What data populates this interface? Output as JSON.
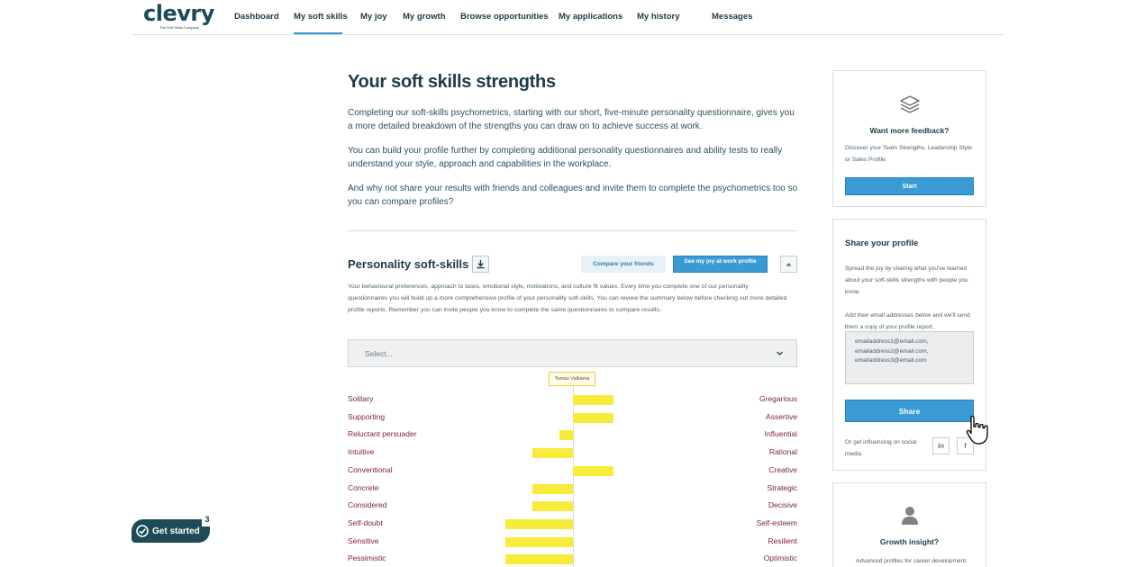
{
  "brand": {
    "name": "clevry",
    "tagline": "The Soft Skills Company"
  },
  "nav": {
    "items": [
      {
        "label": "Dashboard",
        "active": false
      },
      {
        "label": "My soft skills",
        "active": true
      },
      {
        "label": "My joy",
        "active": false
      },
      {
        "label": "My growth",
        "active": false
      },
      {
        "label": "Browse opportunities",
        "active": false
      },
      {
        "label": "My applications",
        "active": false
      },
      {
        "label": "My history",
        "active": false
      },
      {
        "label": "Messages",
        "active": false
      }
    ]
  },
  "main": {
    "title": "Your soft skills strengths",
    "paragraphs": [
      "Completing our soft-skills psychometrics, starting with our short, five-minute personality questionnaire, gives you a more detailed breakdown of the strengths you can draw on to achieve success at work.",
      "You can build your profile further by completing additional personality questionnaires and ability tests to really understand your style, approach and capabilities in the workplace.",
      "And why not share your results with friends and colleagues and invite them to complete the psychometrics too so you can compare profiles?"
    ]
  },
  "personality": {
    "title": "Personality soft-skills",
    "compare_label": "Compare your friends",
    "joy_label": "See my joy at work profile",
    "description": "Your behavioural preferences, approach to tasks, emotional style, motivations, and culture fit values. Every time you complete one of our personality questionnaires you will build up a more comprehensive profile of your personality soft-skills. You can review the summary below before checking out more detailed profile reports. Remember you can invite people you know to complete the same questionnaires to compare results.",
    "select_placeholder": "Select...",
    "person_name": "Tomas Valkama"
  },
  "chart_data": {
    "type": "bar",
    "orientation": "diverging-horizontal",
    "series": [
      {
        "name": "Tomas Valkama"
      }
    ],
    "traits": [
      {
        "left": "Solitary",
        "right": "Gregarious",
        "value": 3
      },
      {
        "left": "Supporting",
        "right": "Assertive",
        "value": 3
      },
      {
        "left": "Reluctant persuader",
        "right": "Influential",
        "value": -1
      },
      {
        "left": "Intuitive",
        "right": "Rational",
        "value": -3
      },
      {
        "left": "Conventional",
        "right": "Creative",
        "value": 3
      },
      {
        "left": "Concrete",
        "right": "Strategic",
        "value": -3
      },
      {
        "left": "Considered",
        "right": "Decisive",
        "value": -3
      },
      {
        "left": "Self-doubt",
        "right": "Self-esteem",
        "value": -5
      },
      {
        "left": "Sensitive",
        "right": "Resilient",
        "value": -5
      },
      {
        "left": "Pessimistic",
        "right": "Optimistic",
        "value": -5
      }
    ],
    "xlim": [
      -5,
      5
    ],
    "bar_color": "#f7ec3a"
  },
  "sidebar": {
    "feedback": {
      "icon": "layers-icon",
      "title": "Want more feedback?",
      "text": "Discover your Team Strengths, Leadership Style or Sales Profile.",
      "button": "Start"
    },
    "share": {
      "title": "Share your profile",
      "text1": "Spread the joy by sharing what you've learned about your soft-skills strengths with people you know.",
      "text2": "Add their email addresses below and we'll send them a copy of your profile report.",
      "email_placeholder": "emailaddress1@email.com,\nemailaddress2@email.com,\nemailaddress3@email.com",
      "button": "Share",
      "social_text": "Or get influencing on social media.",
      "linkedin": "in",
      "facebook": "f"
    },
    "growth": {
      "icon": "person-icon",
      "title": "Growth insight?",
      "text": "Advanced profiles for career development."
    }
  },
  "get_started": {
    "label": "Get started",
    "badge": "3"
  }
}
